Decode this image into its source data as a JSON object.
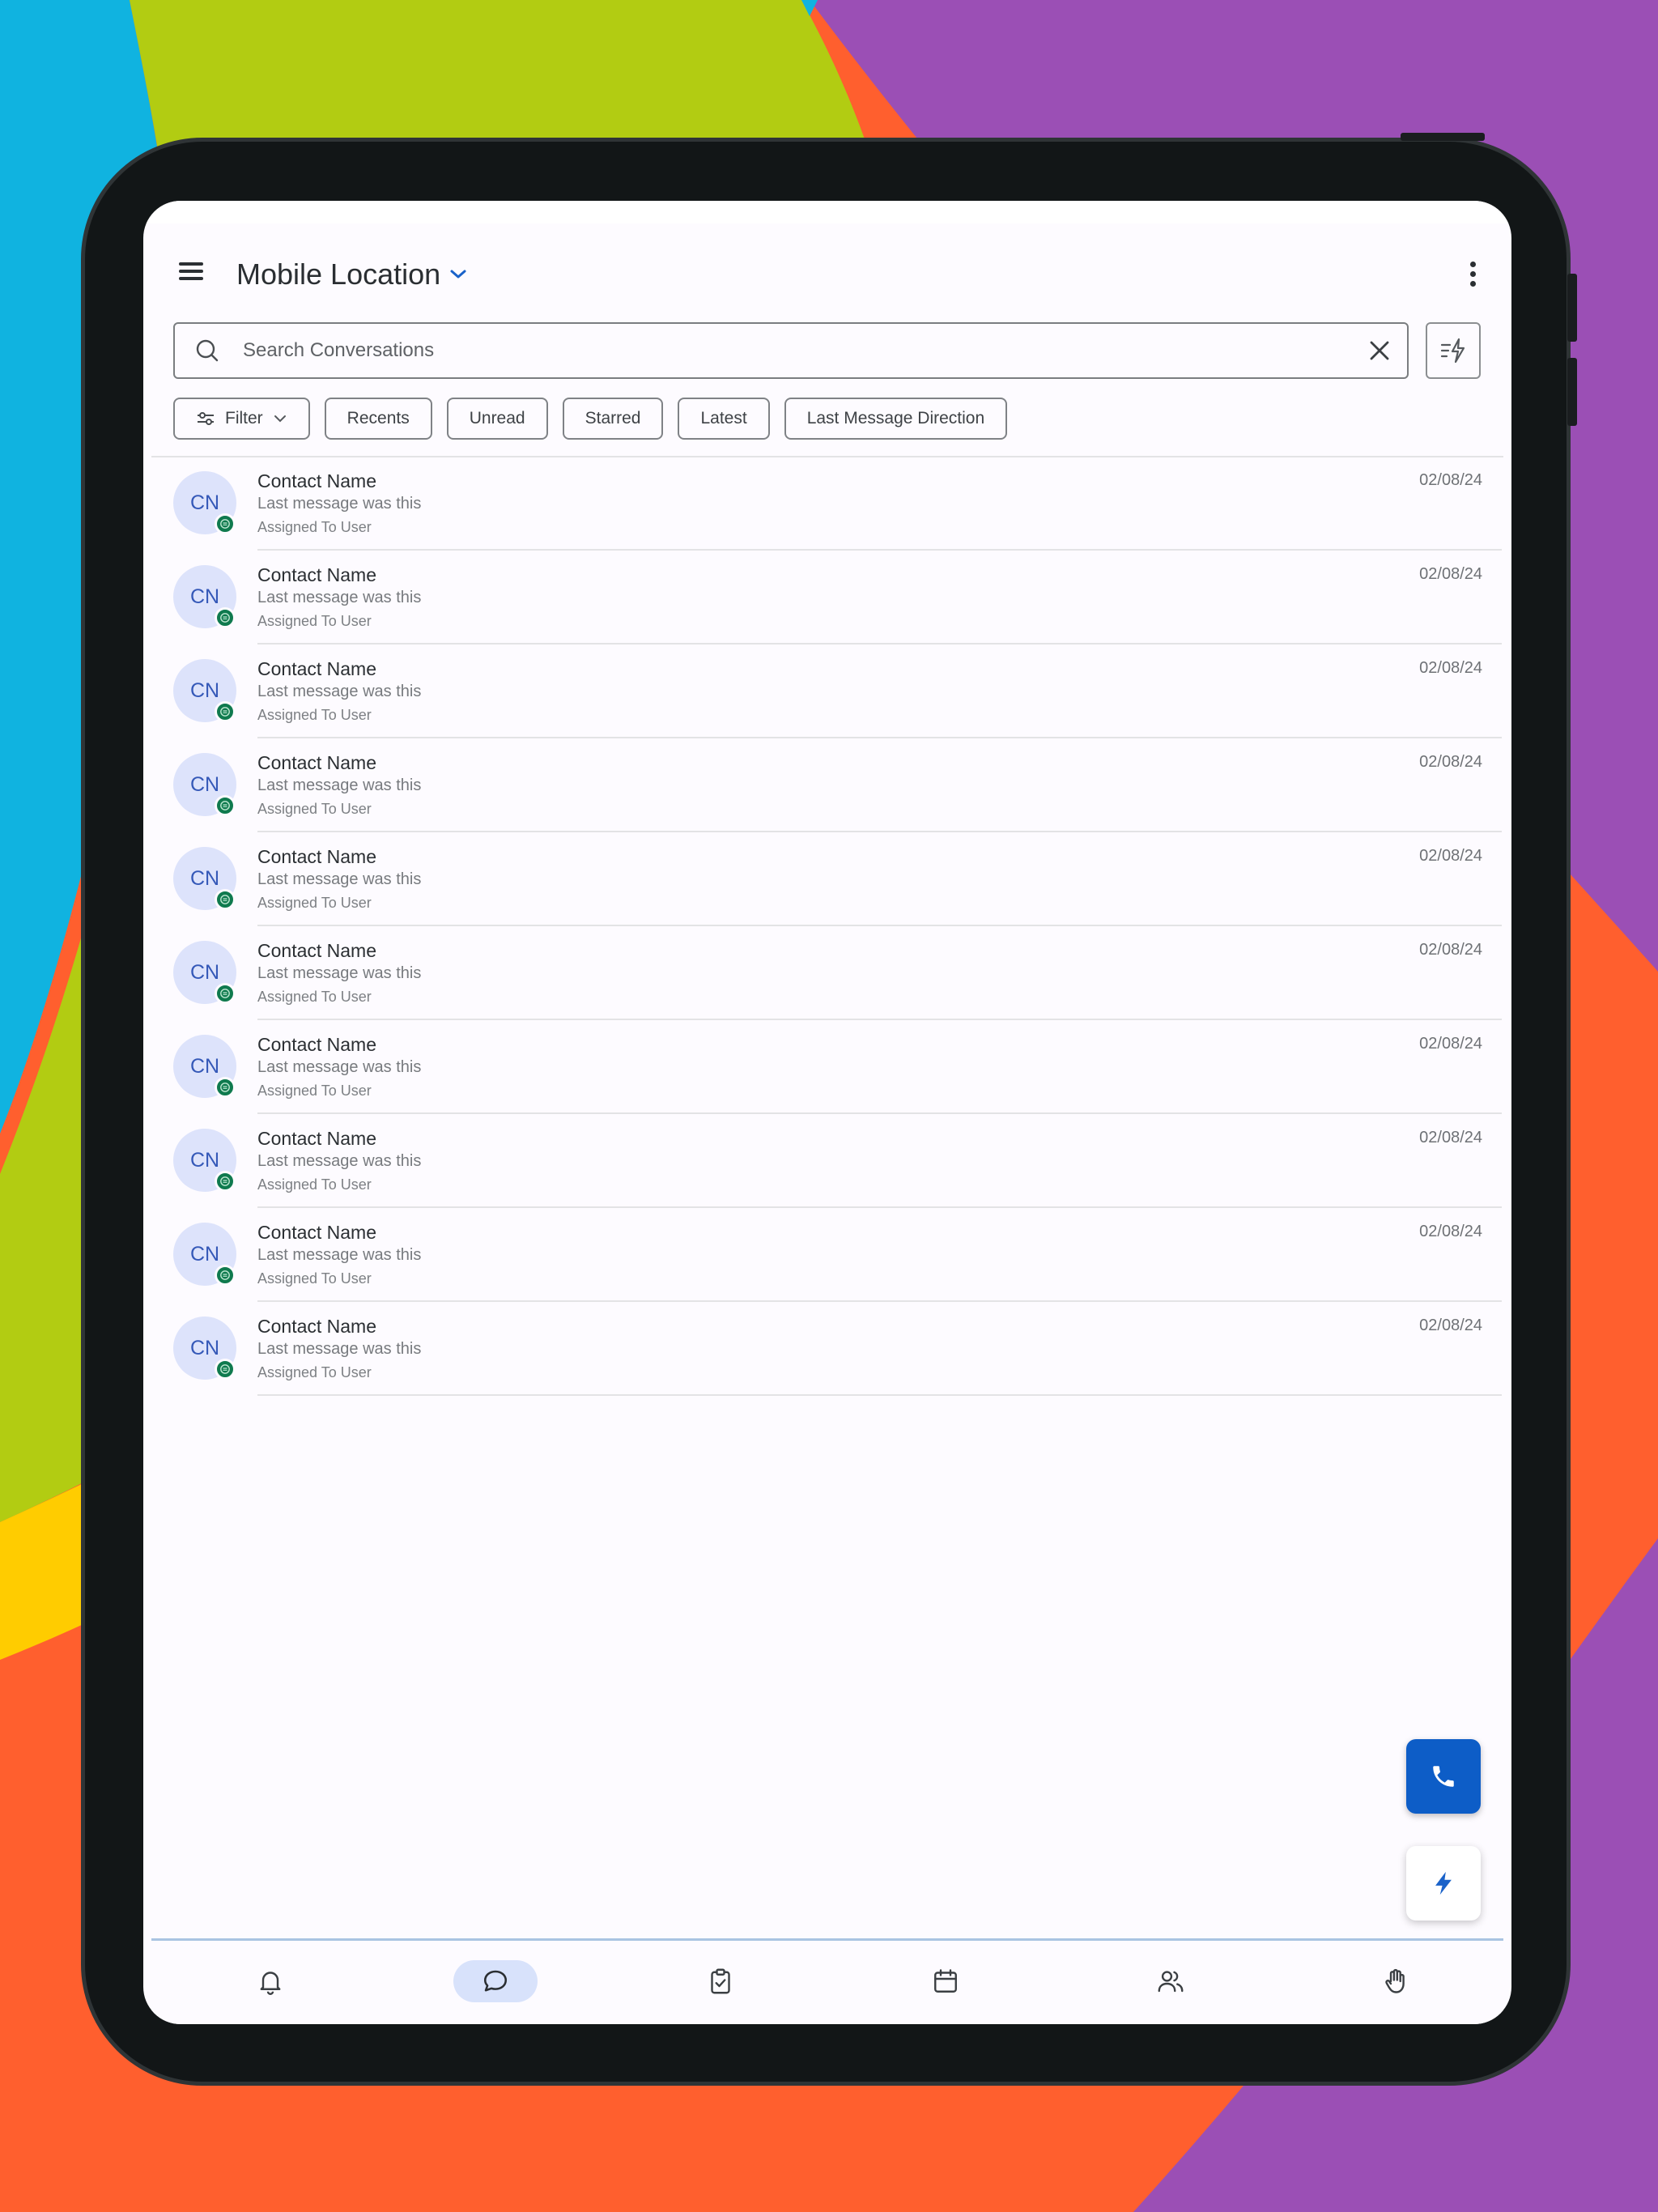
{
  "header": {
    "location_title": "Mobile Location"
  },
  "search": {
    "placeholder": "Search Conversations",
    "value": ""
  },
  "chips": [
    {
      "label": "Filter"
    },
    {
      "label": "Recents"
    },
    {
      "label": "Unread"
    },
    {
      "label": "Starred"
    },
    {
      "label": "Latest"
    },
    {
      "label": "Last Message Direction"
    }
  ],
  "conversations": [
    {
      "initials": "CN",
      "name": "Contact Name",
      "last_message": "Last message was this",
      "assigned": "Assigned To User",
      "date": "02/08/24"
    },
    {
      "initials": "CN",
      "name": "Contact Name",
      "last_message": "Last message was this",
      "assigned": "Assigned To User",
      "date": "02/08/24"
    },
    {
      "initials": "CN",
      "name": "Contact Name",
      "last_message": "Last message was this",
      "assigned": "Assigned To User",
      "date": "02/08/24"
    },
    {
      "initials": "CN",
      "name": "Contact Name",
      "last_message": "Last message was this",
      "assigned": "Assigned To User",
      "date": "02/08/24"
    },
    {
      "initials": "CN",
      "name": "Contact Name",
      "last_message": "Last message was this",
      "assigned": "Assigned To User",
      "date": "02/08/24"
    },
    {
      "initials": "CN",
      "name": "Contact Name",
      "last_message": "Last message was this",
      "assigned": "Assigned To User",
      "date": "02/08/24"
    },
    {
      "initials": "CN",
      "name": "Contact Name",
      "last_message": "Last message was this",
      "assigned": "Assigned To User",
      "date": "02/08/24"
    },
    {
      "initials": "CN",
      "name": "Contact Name",
      "last_message": "Last message was this",
      "assigned": "Assigned To User",
      "date": "02/08/24"
    },
    {
      "initials": "CN",
      "name": "Contact Name",
      "last_message": "Last message was this",
      "assigned": "Assigned To User",
      "date": "02/08/24"
    },
    {
      "initials": "CN",
      "name": "Contact Name",
      "last_message": "Last message was this",
      "assigned": "Assigned To User",
      "date": "02/08/24"
    }
  ],
  "icons": {
    "menu": "menu-icon",
    "dropdown": "chevron-down-icon",
    "more": "more-vert-icon",
    "search": "search-icon",
    "clear": "close-icon",
    "quick_filter": "filter-lightning-icon",
    "filter": "sliders-icon",
    "channel_badge": "chat-badge-icon",
    "call": "phone-icon",
    "quick_action": "lightning-icon",
    "nav": [
      "bell-icon",
      "chat-bubble-icon",
      "clipboard-check-icon",
      "calendar-icon",
      "users-icon",
      "hand-icon"
    ]
  },
  "bottom_nav_active": "chat-bubble-icon",
  "colors": {
    "primary": "#0d5dc7",
    "avatar_bg": "#dde3fb",
    "avatar_text": "#3559b8",
    "badge_green": "#0f7a4e",
    "nav_active_bg": "#d8e2fb"
  }
}
